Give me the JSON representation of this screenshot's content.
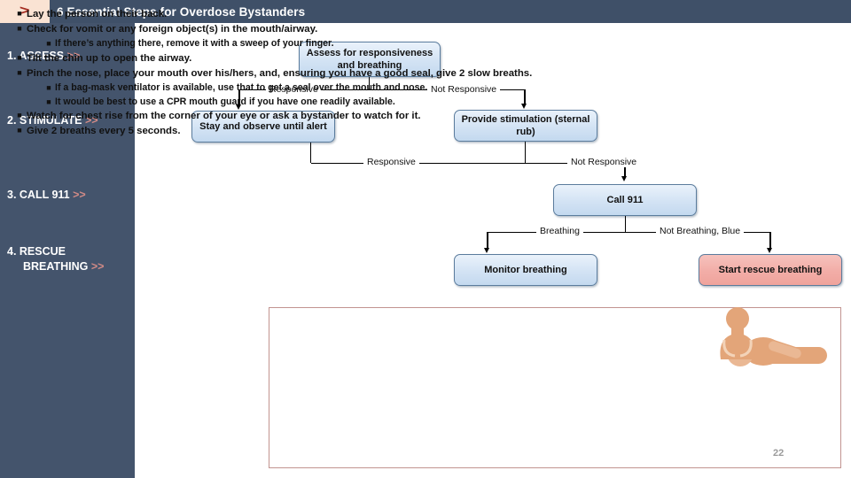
{
  "header": {
    "chevron_icon": "chevron-right-icon",
    "title": "6 Essential Steps for Overdose Bystanders"
  },
  "sidebar": {
    "items": [
      {
        "label": "1. ASSESS",
        "chevrons": ">>",
        "label2": ""
      },
      {
        "label": "2. STIMULATE",
        "chevrons": ">>",
        "label2": ""
      },
      {
        "label": "3. CALL 911",
        "chevrons": ">>",
        "label2": ""
      },
      {
        "label": "4. RESCUE",
        "chevrons": ">>",
        "label2": "BREATHING"
      }
    ]
  },
  "flowchart": {
    "boxes": {
      "assess": "Assess for responsiveness and breathing",
      "stay": "Stay and observe until alert",
      "stimulate": "Provide stimulation (sternal rub)",
      "call911": "Call 911",
      "monitor": "Monitor breathing",
      "rescue": "Start rescue breathing"
    },
    "branch_labels": {
      "responsive_1": "Responsive",
      "not_responsive_1": "Not Responsive",
      "responsive_2": "Responsive",
      "not_responsive_2": "Not Responsive",
      "breathing": "Breathing",
      "not_breathing_blue": "Not Breathing, Blue"
    }
  },
  "bullets": [
    {
      "level": 1,
      "text": "Lay the person on their back."
    },
    {
      "level": 1,
      "text": "Check for vomit or any foreign object(s) in the mouth/airway."
    },
    {
      "level": 2,
      "text": "If there’s anything there, remove it with a sweep of your finger."
    },
    {
      "level": 1,
      "text": "Tilt the chin up to open the airway."
    },
    {
      "level": 1,
      "text": "Pinch the nose, place your mouth over his/hers, and, ensuring you have a good seal, give 2 slow breaths."
    },
    {
      "level": 2,
      "text": "If a bag-mask ventilator is available, use that to get a seal over the mouth and nose."
    },
    {
      "level": 2,
      "text": "It would be best to use a CPR mouth guard if you have one readily available."
    },
    {
      "level": 1,
      "text": "Watch for chest rise from the corner of your eye or ask a bystander to watch for it."
    },
    {
      "level": 1,
      "text": "Give 2 breaths every 5 seconds."
    }
  ],
  "illustration": {
    "name": "rescue-breathing-illustration"
  },
  "page_number": "22",
  "colors": {
    "header_bg": "#3f5068",
    "sidebar_bg": "#44546c",
    "chevron_accent": "#d08a86",
    "box_fill": "#d3e3f4",
    "box_border": "#5b7c9d",
    "alert_box_fill": "#f2ada7",
    "panel_border": "#c29490",
    "illustration": "#e0a478"
  }
}
